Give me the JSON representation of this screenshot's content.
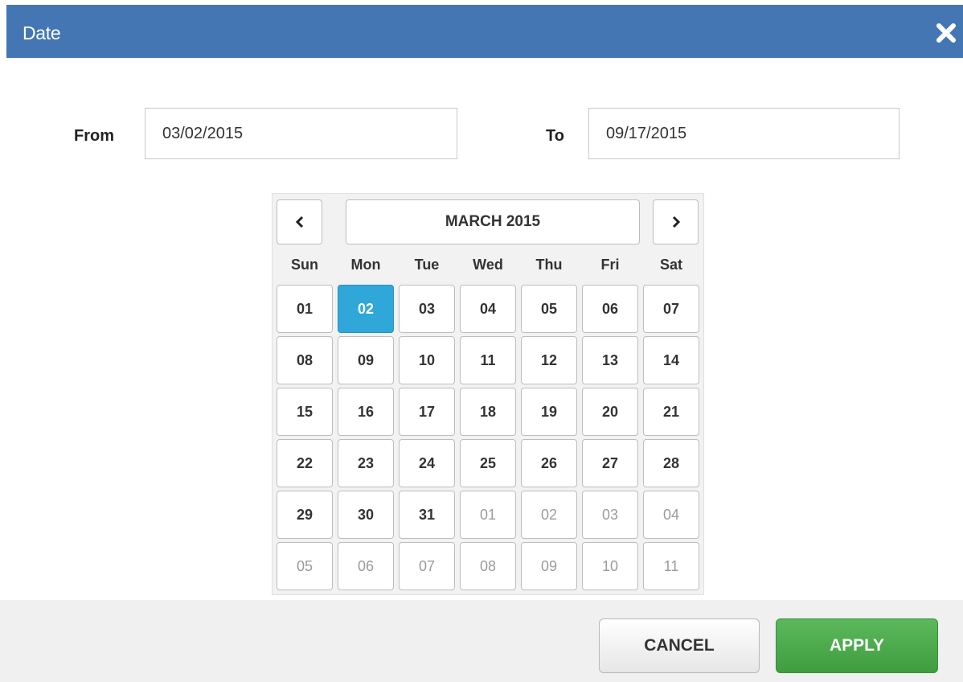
{
  "dialog": {
    "title": "Date"
  },
  "from": {
    "label": "From",
    "value": "03/02/2015"
  },
  "to": {
    "label": "To",
    "value": "09/17/2015"
  },
  "calendar": {
    "prev_icon": "chevron-left-icon",
    "next_icon": "chevron-right-icon",
    "month_label": "MARCH 2015",
    "weekdays": [
      "Sun",
      "Mon",
      "Tue",
      "Wed",
      "Thu",
      "Fri",
      "Sat"
    ],
    "selected": "02",
    "weeks": [
      [
        "01",
        "02",
        "03",
        "04",
        "05",
        "06",
        "07"
      ],
      [
        "08",
        "09",
        "10",
        "11",
        "12",
        "13",
        "14"
      ],
      [
        "15",
        "16",
        "17",
        "18",
        "19",
        "20",
        "21"
      ],
      [
        "22",
        "23",
        "24",
        "25",
        "26",
        "27",
        "28"
      ],
      [
        "29",
        "30",
        "31",
        "01",
        "02",
        "03",
        "04"
      ],
      [
        "05",
        "06",
        "07",
        "08",
        "09",
        "10",
        "11"
      ]
    ],
    "other_month": [
      [
        false,
        false,
        false,
        false,
        false,
        false,
        false
      ],
      [
        false,
        false,
        false,
        false,
        false,
        false,
        false
      ],
      [
        false,
        false,
        false,
        false,
        false,
        false,
        false
      ],
      [
        false,
        false,
        false,
        false,
        false,
        false,
        false
      ],
      [
        false,
        false,
        false,
        true,
        true,
        true,
        true
      ],
      [
        true,
        true,
        true,
        true,
        true,
        true,
        true
      ]
    ]
  },
  "footer": {
    "cancel_label": "CANCEL",
    "apply_label": "APPLY"
  },
  "colors": {
    "header": "#4476b4",
    "selected": "#2fa7d8",
    "apply": "#4cae4c"
  }
}
